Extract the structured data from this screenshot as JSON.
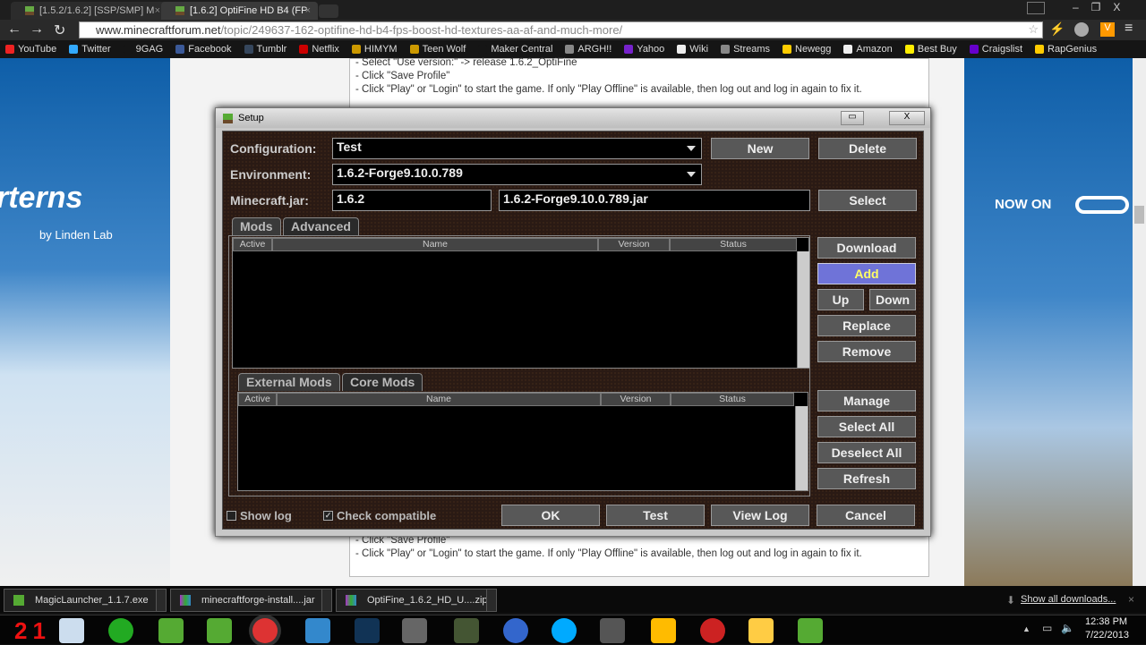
{
  "browser": {
    "tabs": [
      {
        "title": "[1.5.2/1.6.2] [SSP/SMP] M"
      },
      {
        "title": "[1.6.2] OptiFine HD B4 (FP"
      }
    ],
    "url_host": "www.minecraftforum.net",
    "url_path": "/topic/249637-162-optifine-hd-b4-fps-boost-hd-textures-aa-af-and-much-more/",
    "bookmarks": [
      {
        "label": "YouTube",
        "color": "#e22"
      },
      {
        "label": "Twitter",
        "color": "#3af"
      },
      {
        "label": "9GAG",
        "color": "#151515"
      },
      {
        "label": "Facebook",
        "color": "#3b5998"
      },
      {
        "label": "Tumblr",
        "color": "#35465c"
      },
      {
        "label": "Netflix",
        "color": "#c00"
      },
      {
        "label": "HIMYM",
        "color": "#c90"
      },
      {
        "label": "Teen Wolf",
        "color": "#c90"
      },
      {
        "label": "Maker Central",
        "color": "#151515"
      },
      {
        "label": "ARGH!!",
        "color": "#888"
      },
      {
        "label": "Yahoo",
        "color": "#72c"
      },
      {
        "label": "Wiki",
        "color": "#eee"
      },
      {
        "label": "Streams",
        "color": "#888"
      },
      {
        "label": "Newegg",
        "color": "#fc0"
      },
      {
        "label": "Amazon",
        "color": "#eee"
      },
      {
        "label": "Best Buy",
        "color": "#fe0"
      },
      {
        "label": "Craigslist",
        "color": "#60c"
      },
      {
        "label": "RapGenius",
        "color": "#fc0"
      }
    ]
  },
  "page": {
    "top_lines": [
      "- Select \"Use version:\" -> release 1.6.2_OptiFine",
      "- Click \"Save Profile\"",
      "- Click \"Play\" or \"Login\" to start the game. If only \"Play Offline\" is available, then log out and log in again to fix it."
    ],
    "bottom_lines": [
      "- Click \"Save Profile\"",
      "- Click \"Play\" or \"Login\" to start the game. If only \"Play Offline\" is available, then log out and log in again to fix it."
    ],
    "left_ad": {
      "brand": "rterns",
      "sub": "by Linden Lab"
    },
    "right_ad": {
      "text": "NOW ON"
    }
  },
  "dialog": {
    "title": "Setup",
    "configuration_label": "Configuration:",
    "configuration_value": "Test",
    "environment_label": "Environment:",
    "environment_value": "1.6.2-Forge9.10.0.789",
    "jar_label": "Minecraft.jar:",
    "jar_version": "1.6.2",
    "jar_file": "1.6.2-Forge9.10.0.789.jar",
    "new": "New",
    "delete": "Delete",
    "select": "Select",
    "tabs": [
      "Mods",
      "Advanced"
    ],
    "columns": [
      "Active",
      "Name",
      "Version",
      "Status"
    ],
    "mod_buttons": [
      "Download",
      "Add",
      "Up",
      "Down",
      "Replace",
      "Remove"
    ],
    "lower_tabs": [
      "External Mods",
      "Core Mods"
    ],
    "lower_buttons": [
      "Manage",
      "Select All",
      "Deselect All",
      "Refresh"
    ],
    "show_log": "Show log",
    "show_log_checked": false,
    "check_compatible": "Check compatible",
    "check_compatible_checked": true,
    "footer_buttons": [
      "OK",
      "Test",
      "View Log",
      "Cancel"
    ]
  },
  "downloads": {
    "items": [
      "MagicLauncher_1.1.7.exe",
      "minecraftforge-install....jar",
      "OptiFine_1.6.2_HD_U....zip"
    ],
    "show_all": "Show all downloads..."
  },
  "taskbar": {
    "time": "12:38 PM",
    "date": "7/22/2013",
    "counter": "21"
  }
}
